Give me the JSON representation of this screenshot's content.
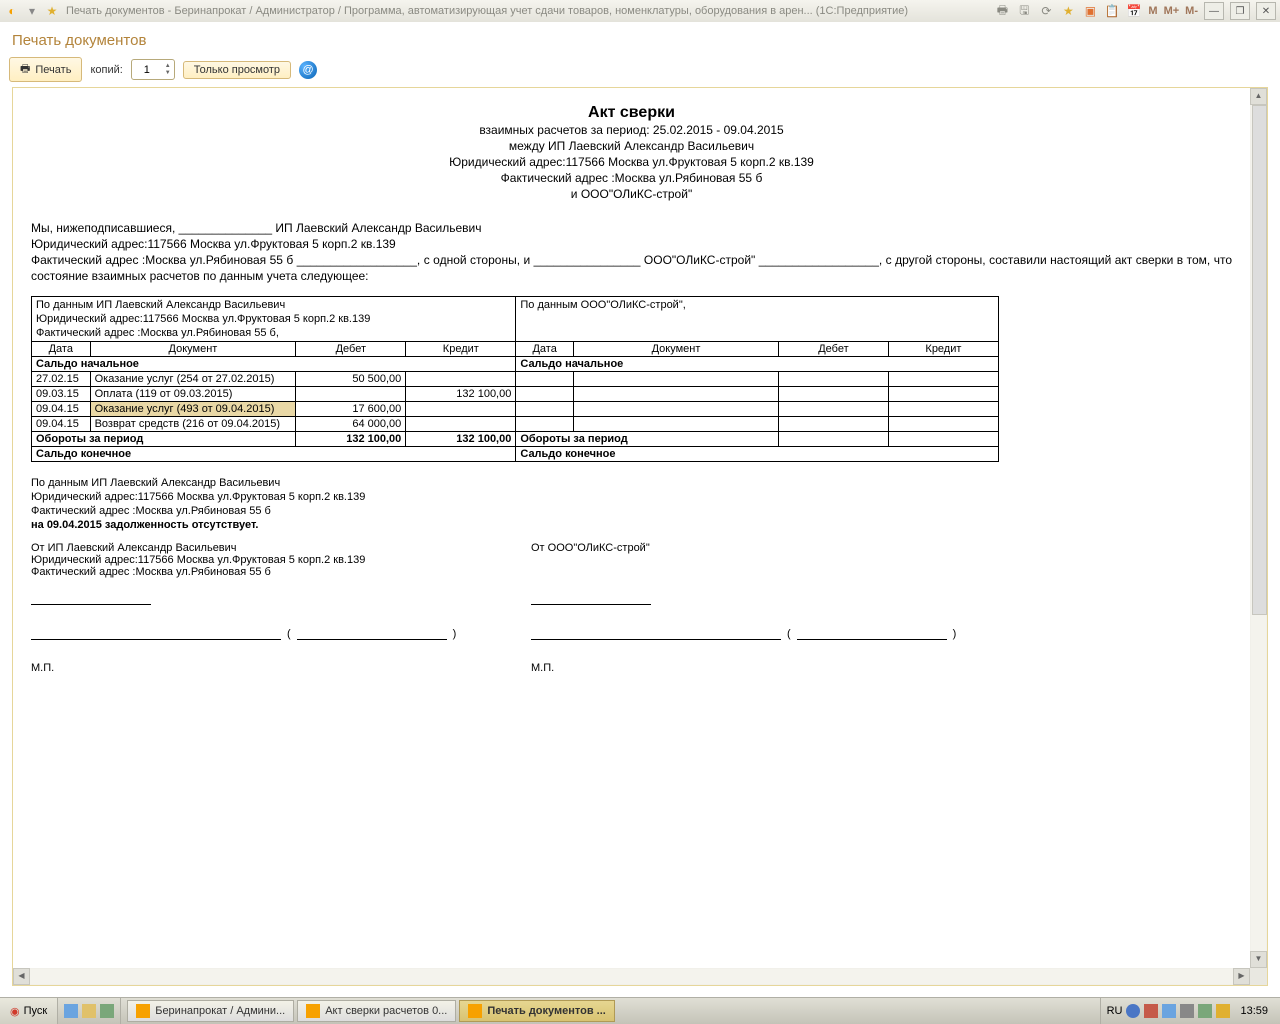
{
  "titlebar": {
    "text": "Печать документов - Беринапрокат / Администратор / Программа, автоматизирующая учет сдачи товаров, номенклатуры, оборудования в арен...   (1С:Предприятие)",
    "right_labels": {
      "m": "M",
      "m_plus": "M+",
      "m_minus": "M-"
    }
  },
  "page": {
    "title": "Печать документов"
  },
  "toolbar": {
    "print_label": "Печать",
    "copies_label": "копий:",
    "copies_value": "1",
    "only_view_label": "Только просмотр"
  },
  "doc": {
    "title": "Акт сверки",
    "sub1": "взаимных расчетов за период: 25.02.2015 - 09.04.2015",
    "sub2": "между ИП Лаевский Александр Васильевич",
    "sub3": "Юридический адрес:117566 Москва ул.Фруктовая 5 корп.2 кв.139",
    "sub4": "Фактический адрес :Москва ул.Рябиновая 55 б",
    "sub5": "и ООО\"ОЛиКС-строй\""
  },
  "preamble": {
    "p1": "Мы, нижеподписавшиеся, ______________ ИП Лаевский Александр Васильевич",
    "p2": "Юридический адрес:117566 Москва ул.Фруктовая 5 корп.2 кв.139",
    "p3": "Фактический    адрес    :Москва    ул.Рябиновая    55    б    __________________,    с    одной    стороны,    и    ________________    ООО\"ОЛиКС-строй\" __________________, с другой стороны, составили настоящий акт сверки в том, что состояние взаимных расчетов по данным учета следующее:"
  },
  "table": {
    "left_header": "По данным ИП Лаевский Александр Васильевич",
    "left_addr1": "Юридический адрес:117566 Москва ул.Фруктовая 5 корп.2 кв.139",
    "left_addr2": "Фактический адрес :Москва ул.Рябиновая 55 б,",
    "right_header": "По данным ООО\"ОЛиКС-строй\",",
    "cols": {
      "date": "Дата",
      "doc": "Документ",
      "debit": "Дебет",
      "credit": "Кредит"
    },
    "saldo_start": "Сальдо начальное",
    "turnover": "Обороты за период",
    "saldo_end": "Сальдо конечное",
    "rows": [
      {
        "date": "27.02.15",
        "doc": "Оказание услуг (254 от 27.02.2015)",
        "debit": "50 500,00",
        "credit": ""
      },
      {
        "date": "09.03.15",
        "doc": "Оплата (119 от 09.03.2015)",
        "debit": "",
        "credit": "132 100,00"
      },
      {
        "date": "09.04.15",
        "doc": "Оказание услуг (493 от 09.04.2015)",
        "debit": "17 600,00",
        "credit": "",
        "selected": true
      },
      {
        "date": "09.04.15",
        "doc": "Возврат средств (216 от 09.04.2015)",
        "debit": "64 000,00",
        "credit": ""
      }
    ],
    "turnover_debit": "132 100,00",
    "turnover_credit": "132 100,00"
  },
  "footer": {
    "f1": "По данным ИП Лаевский Александр Васильевич",
    "f2": "Юридический адрес:117566 Москва ул.Фруктовая 5 корп.2 кв.139",
    "f3": "Фактический адрес :Москва ул.Рябиновая 55 б",
    "f4": "на 09.04.2015 задолженность отсутствует.",
    "sig_left_from": "От ИП Лаевский Александр Васильевич",
    "sig_left_a1": "Юридический адрес:117566 Москва ул.Фруктовая 5 корп.2 кв.139",
    "sig_left_a2": "Фактический адрес :Москва ул.Рябиновая 55 б",
    "sig_right_from": "От ООО\"ОЛиКС-строй\"",
    "mp": "М.П."
  },
  "taskbar": {
    "start": "Пуск",
    "tasks": [
      "Беринапрокат / Админи...",
      "Акт сверки расчетов 0...",
      "Печать документов ..."
    ],
    "lang": "RU",
    "clock": "13:59"
  }
}
